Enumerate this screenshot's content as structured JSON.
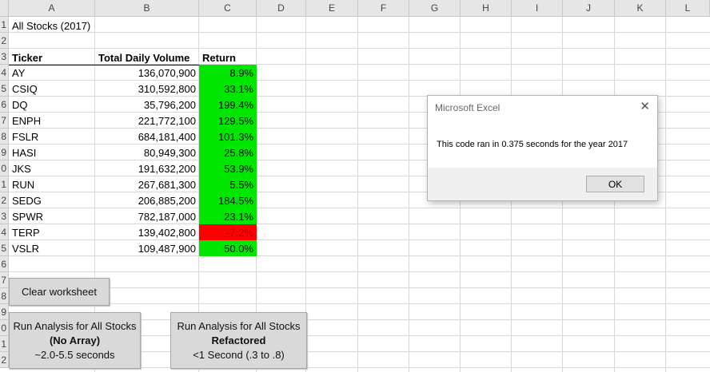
{
  "columns": [
    "A",
    "B",
    "C",
    "D",
    "E",
    "F",
    "G",
    "H",
    "I",
    "J",
    "K",
    "L"
  ],
  "row_numbers": [
    "1",
    "2",
    "3",
    "4",
    "5",
    "6",
    "7",
    "8",
    "9",
    "0",
    "1",
    "2",
    "3",
    "4",
    "5",
    "6",
    "7",
    "8",
    "9",
    "0",
    "1",
    "2"
  ],
  "sheet": {
    "title": "All Stocks (2017)",
    "headers": {
      "ticker": "Ticker",
      "volume": "Total Daily Volume",
      "return": "Return"
    },
    "rows": [
      {
        "ticker": "AY",
        "volume": "136,070,900",
        "return": "8.9%",
        "negative": false
      },
      {
        "ticker": "CSIQ",
        "volume": "310,592,800",
        "return": "33.1%",
        "negative": false
      },
      {
        "ticker": "DQ",
        "volume": "35,796,200",
        "return": "199.4%",
        "negative": false
      },
      {
        "ticker": "ENPH",
        "volume": "221,772,100",
        "return": "129.5%",
        "negative": false
      },
      {
        "ticker": "FSLR",
        "volume": "684,181,400",
        "return": "101.3%",
        "negative": false
      },
      {
        "ticker": "HASI",
        "volume": "80,949,300",
        "return": "25.8%",
        "negative": false
      },
      {
        "ticker": "JKS",
        "volume": "191,632,200",
        "return": "53.9%",
        "negative": false
      },
      {
        "ticker": "RUN",
        "volume": "267,681,300",
        "return": "5.5%",
        "negative": false
      },
      {
        "ticker": "SEDG",
        "volume": "206,885,200",
        "return": "184.5%",
        "negative": false
      },
      {
        "ticker": "SPWR",
        "volume": "782,187,000",
        "return": "23.1%",
        "negative": false
      },
      {
        "ticker": "TERP",
        "volume": "139,402,800",
        "return": "-7.2%",
        "negative": true
      },
      {
        "ticker": "VSLR",
        "volume": "109,487,900",
        "return": "50.0%",
        "negative": false
      }
    ]
  },
  "colors": {
    "positive": "#00e600",
    "negative": "#ff0000"
  },
  "buttons": {
    "clear": "Clear worksheet",
    "run_no_array": {
      "line1": "Run Analysis for All Stocks",
      "line2": "(No Array)",
      "line3": "~2.0-5.5 seconds"
    },
    "run_refactored": {
      "line1": "Run Analysis for All Stocks",
      "line2": "Refactored",
      "line3": "<1 Second (.3 to .8)"
    }
  },
  "dialog": {
    "title": "Microsoft Excel",
    "close_icon": "close-icon",
    "message": "This code ran in 0.375 seconds for the year 2017",
    "ok": "OK"
  }
}
